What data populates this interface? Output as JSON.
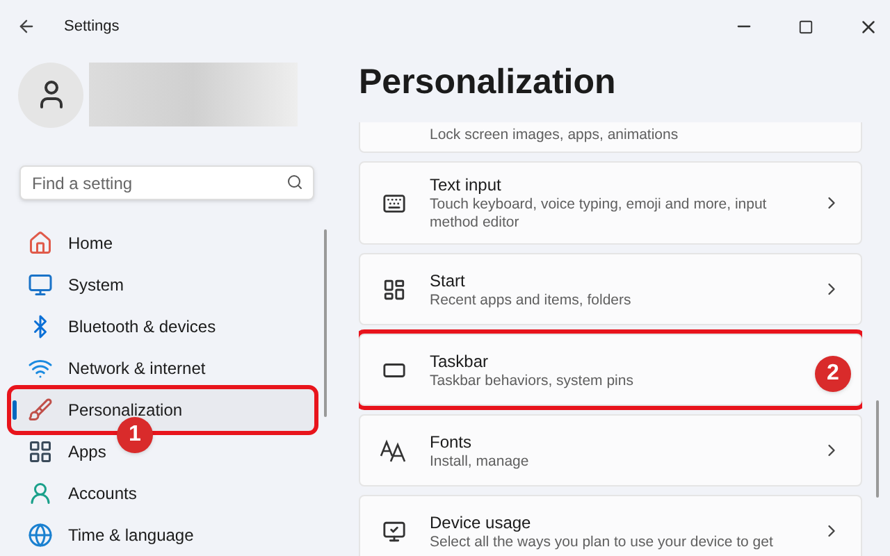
{
  "window": {
    "title": "Settings"
  },
  "search": {
    "placeholder": "Find a setting"
  },
  "nav": [
    {
      "label": "Home",
      "selected": false
    },
    {
      "label": "System",
      "selected": false
    },
    {
      "label": "Bluetooth & devices",
      "selected": false
    },
    {
      "label": "Network & internet",
      "selected": false
    },
    {
      "label": "Personalization",
      "selected": true,
      "highlighted": true,
      "callout": "1"
    },
    {
      "label": "Apps",
      "selected": false
    },
    {
      "label": "Accounts",
      "selected": false
    },
    {
      "label": "Time & language",
      "selected": false
    }
  ],
  "page": {
    "title": "Personalization"
  },
  "cards": [
    {
      "subtitle": "Lock screen images, apps, animations",
      "chevron": false,
      "highlighted": false
    },
    {
      "title": "Text input",
      "subtitle": "Touch keyboard, voice typing, emoji and more, input method editor",
      "chevron": true,
      "highlighted": false
    },
    {
      "title": "Start",
      "subtitle": "Recent apps and items, folders",
      "chevron": true,
      "highlighted": false
    },
    {
      "title": "Taskbar",
      "subtitle": "Taskbar behaviors, system pins",
      "chevron": false,
      "highlighted": true,
      "callout": "2"
    },
    {
      "title": "Fonts",
      "subtitle": "Install, manage",
      "chevron": true,
      "highlighted": false
    },
    {
      "title": "Device usage",
      "subtitle": "Select all the ways you plan to use your device to get",
      "chevron": true,
      "highlighted": false
    }
  ]
}
